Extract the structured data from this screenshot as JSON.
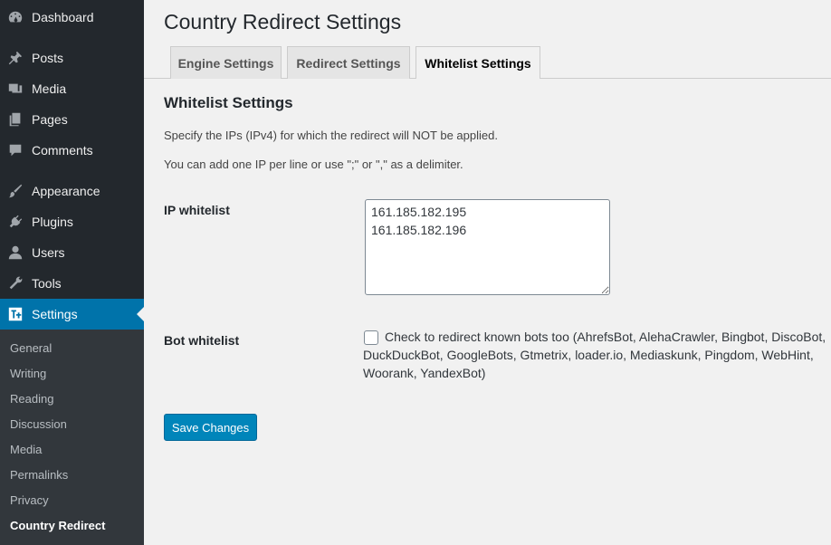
{
  "sidebar": {
    "items": [
      {
        "label": "Dashboard",
        "icon": "dashboard-icon"
      },
      {
        "label": "Posts",
        "icon": "pin-icon"
      },
      {
        "label": "Media",
        "icon": "media-icon"
      },
      {
        "label": "Pages",
        "icon": "pages-icon"
      },
      {
        "label": "Comments",
        "icon": "comment-icon"
      },
      {
        "label": "Appearance",
        "icon": "brush-icon"
      },
      {
        "label": "Plugins",
        "icon": "plug-icon"
      },
      {
        "label": "Users",
        "icon": "user-icon"
      },
      {
        "label": "Tools",
        "icon": "wrench-icon"
      },
      {
        "label": "Settings",
        "icon": "settings-icon",
        "current": true
      }
    ],
    "submenu": [
      "General",
      "Writing",
      "Reading",
      "Discussion",
      "Media",
      "Permalinks",
      "Privacy",
      "Country Redirect"
    ],
    "submenu_current": "Country Redirect"
  },
  "page": {
    "title": "Country Redirect Settings",
    "tabs": [
      "Engine Settings",
      "Redirect Settings",
      "Whitelist Settings"
    ],
    "active_tab": "Whitelist Settings",
    "section_heading": "Whitelist Settings",
    "description_1": "Specify the IPs (IPv4) for which the redirect will NOT be applied.",
    "description_2": "You can add one IP per line or use \";\" or \",\" as a delimiter.",
    "ip_whitelist": {
      "label": "IP whitelist",
      "value": "161.185.182.195\n161.185.182.196"
    },
    "bot_whitelist": {
      "label": "Bot whitelist",
      "checked": false,
      "checkbox_label": "Check to redirect known bots too (AhrefsBot, AlehaCrawler, Bingbot, DiscoBot, DuckDuckBot, GoogleBots, Gtmetrix, loader.io, Mediaskunk, Pingdom, WebHint, Woorank, YandexBot)"
    },
    "save_label": "Save Changes"
  },
  "colors": {
    "sidebar_bg": "#23282d",
    "submenu_bg": "#32373c",
    "accent": "#0073aa",
    "button": "#0085ba",
    "page_bg": "#f1f1f1"
  }
}
